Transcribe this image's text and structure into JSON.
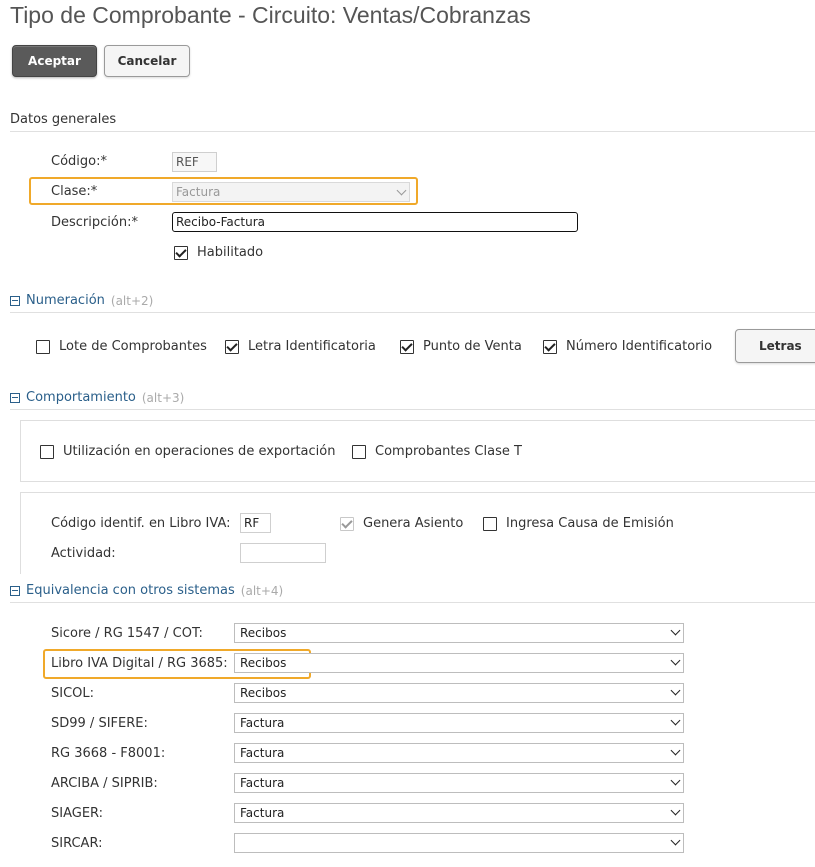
{
  "page": {
    "title": "Tipo de Comprobante - Circuito: Ventas/Cobranzas"
  },
  "toolbar": {
    "accept_label": "Aceptar",
    "cancel_label": "Cancelar"
  },
  "general": {
    "section_label": "Datos generales",
    "codigo_label": "Código:*",
    "codigo_value": "REF",
    "clase_label": "Clase:*",
    "clase_value": "Factura",
    "descripcion_label": "Descripción:*",
    "descripcion_value": "Recibo-Factura",
    "habilitado_label": "Habilitado",
    "habilitado_checked": true
  },
  "numeracion": {
    "header": "Numeración",
    "shortcut": "(alt+2)",
    "lote_label": "Lote de Comprobantes",
    "lote_checked": false,
    "letra_label": "Letra Identificatoria",
    "letra_checked": true,
    "punto_label": "Punto de Venta",
    "punto_checked": true,
    "numero_label": "Número Identificatorio",
    "numero_checked": true,
    "letras_button": "Letras"
  },
  "comportamiento": {
    "header": "Comportamiento",
    "shortcut": "(alt+3)",
    "exportacion_label": "Utilización en operaciones de exportación",
    "exportacion_checked": false,
    "clase_t_label": "Comprobantes Clase T",
    "clase_t_checked": false,
    "libro_iva_label": "Código identif. en Libro IVA:",
    "libro_iva_value": "RF",
    "genera_asiento_label": "Genera Asiento",
    "genera_asiento_checked": true,
    "causa_emision_label": "Ingresa Causa de Emisión",
    "causa_emision_checked": false,
    "actividad_label": "Actividad:",
    "actividad_value": ""
  },
  "equivalencia": {
    "header": "Equivalencia con otros sistemas",
    "shortcut": "(alt+4)",
    "rows": [
      {
        "label": "Sicore / RG 1547 / COT:",
        "value": "Recibos"
      },
      {
        "label": "Libro IVA Digital / RG 3685:",
        "value": "Recibos"
      },
      {
        "label": "SICOL:",
        "value": "Recibos"
      },
      {
        "label": "SD99 / SIFERE:",
        "value": "Factura"
      },
      {
        "label": "RG 3668 - F8001:",
        "value": "Factura"
      },
      {
        "label": "ARCIBA / SIPRIB:",
        "value": "Factura"
      },
      {
        "label": "SIAGER:",
        "value": "Factura"
      },
      {
        "label": "SIRCAR:",
        "value": ""
      }
    ]
  },
  "colors": {
    "section_link": "#2a5f8a",
    "highlight": "#f0a92a",
    "primary_button": "#5a5a5a"
  }
}
